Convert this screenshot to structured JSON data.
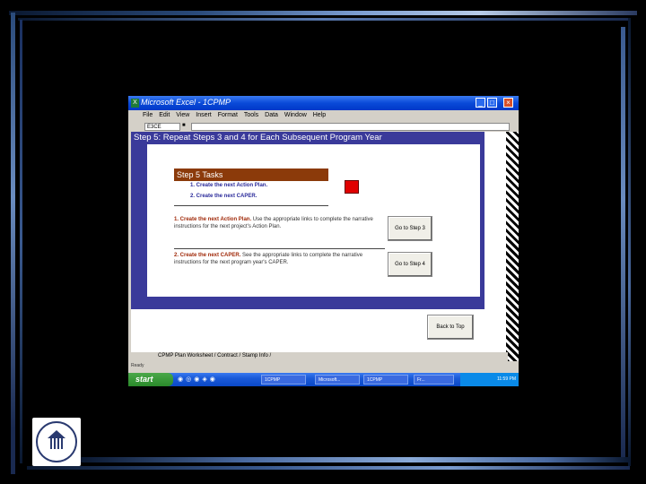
{
  "window": {
    "title": "Microsoft Excel - 1CPMP",
    "menu": [
      "File",
      "Edit",
      "View",
      "Insert",
      "Format",
      "Tools",
      "Data",
      "Window",
      "Help"
    ],
    "name_box": "E3CE"
  },
  "sheet": {
    "step_header": "Step 5: Repeat Steps 3 and 4 for Each Subsequent Program Year",
    "tasks_title": "Step 5 Tasks",
    "task1": "1. Create the next Action Plan.",
    "task2": "2. Create the next CAPER.",
    "desc1_bold": "1. Create the next Action Plan.",
    "desc1_rest": " Use the appropriate links to complete the narrative instructions for the next project's Action Plan.",
    "desc2_bold": "2. Create the next CAPER.",
    "desc2_rest": " See the appropriate links to complete the narrative instructions for the next program year's CAPER.",
    "goto3": "Go to Step 3",
    "goto4": "Go to Step 4",
    "back_top": "Back to Top",
    "tabs": "CPMP Plan Worksheet / Contract / Stamp Info /",
    "status": "Ready",
    "accent_red": "#e00000"
  },
  "taskbar": {
    "start": "start",
    "items": [
      "1CPMP",
      "Microsoft...",
      "1CPMP",
      "Fr..."
    ],
    "clock": "11:59 PM"
  }
}
